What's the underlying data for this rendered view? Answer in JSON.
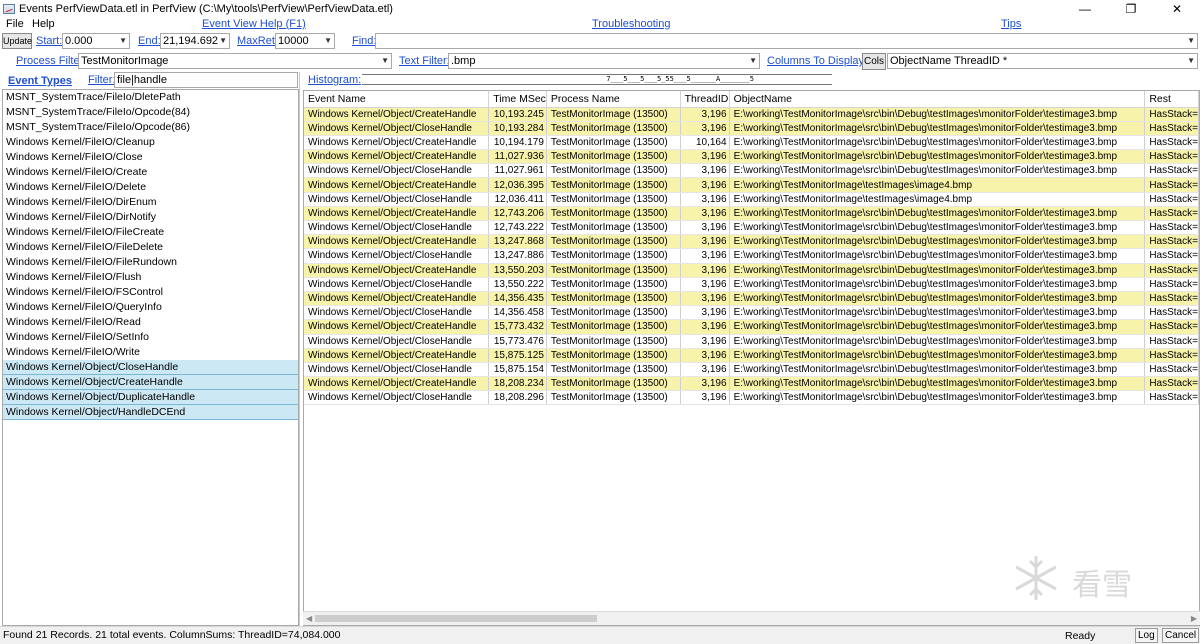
{
  "window": {
    "title": "Events PerfViewData.etl in PerfView (C:\\My\\tools\\PerfView\\PerfViewData.etl)",
    "minimize": "—",
    "maximize": "❐",
    "close": "✕"
  },
  "menu": {
    "file": "File",
    "help": "Help",
    "event_view_help": "Event View Help (F1)",
    "troubleshooting": "Troubleshooting",
    "tips": "Tips"
  },
  "toolbar": {
    "update": "Update",
    "start_label": "Start:",
    "start_value": "0.000",
    "end_label": "End:",
    "end_value": "21,194.692",
    "maxret_label": "MaxRet:",
    "maxret_value": "10000",
    "find_label": "Find:",
    "find_value": "",
    "process_filter_label": "Process Filter:",
    "process_filter_value": "TestMonitorImage",
    "text_filter_label": "Text Filter:",
    "text_filter_value": ".bmp",
    "columns_label": "Columns To Display:",
    "cols_button": "Cols",
    "columns_value": "ObjectName ThreadID *"
  },
  "left": {
    "event_types_label": "Event Types",
    "filter_label": "Filter:",
    "filter_value": "file|handle",
    "items": [
      "MSNT_SystemTrace/FileIo/DletePath",
      "MSNT_SystemTrace/FileIo/Opcode(84)",
      "MSNT_SystemTrace/FileIo/Opcode(86)",
      "Windows Kernel/FileIO/Cleanup",
      "Windows Kernel/FileIO/Close",
      "Windows Kernel/FileIO/Create",
      "Windows Kernel/FileIO/Delete",
      "Windows Kernel/FileIO/DirEnum",
      "Windows Kernel/FileIO/DirNotify",
      "Windows Kernel/FileIO/FileCreate",
      "Windows Kernel/FileIO/FileDelete",
      "Windows Kernel/FileIO/FileRundown",
      "Windows Kernel/FileIO/Flush",
      "Windows Kernel/FileIO/FSControl",
      "Windows Kernel/FileIO/QueryInfo",
      "Windows Kernel/FileIO/Read",
      "Windows Kernel/FileIO/SetInfo",
      "Windows Kernel/FileIO/Write",
      "Windows Kernel/Object/CloseHandle",
      "Windows Kernel/Object/CreateHandle",
      "Windows Kernel/Object/DuplicateHandle",
      "Windows Kernel/Object/HandleDCEnd"
    ],
    "selected_from_index": 18
  },
  "histogram": {
    "label": "Histogram:",
    "text": "                                                          7___5___5___5_55___5______A_______5"
  },
  "grid": {
    "columns": [
      "Event Name",
      "Time MSec",
      "Process Name",
      "ThreadID",
      "ObjectName",
      "Rest"
    ],
    "rows": [
      {
        "event": "Windows Kernel/Object/CreateHandle",
        "time": "10,193.245",
        "process": "TestMonitorImage (13500)",
        "thread": "3,196",
        "object": "E:\\working\\TestMonitorImage\\src\\bin\\Debug\\testImages\\monitorFolder\\testimage3.bmp",
        "rest": "HasStack=",
        "hl": true
      },
      {
        "event": "Windows Kernel/Object/CloseHandle",
        "time": "10,193.284",
        "process": "TestMonitorImage (13500)",
        "thread": "3,196",
        "object": "E:\\working\\TestMonitorImage\\src\\bin\\Debug\\testImages\\monitorFolder\\testimage3.bmp",
        "rest": "HasStack=",
        "hl": true
      },
      {
        "event": "Windows Kernel/Object/CreateHandle",
        "time": "10,194.179",
        "process": "TestMonitorImage (13500)",
        "thread": "10,164",
        "object": "E:\\working\\TestMonitorImage\\src\\bin\\Debug\\testImages\\monitorFolder\\testimage3.bmp",
        "rest": "HasStack=",
        "hl": false
      },
      {
        "event": "Windows Kernel/Object/CreateHandle",
        "time": "11,027.936",
        "process": "TestMonitorImage (13500)",
        "thread": "3,196",
        "object": "E:\\working\\TestMonitorImage\\src\\bin\\Debug\\testImages\\monitorFolder\\testimage3.bmp",
        "rest": "HasStack=",
        "hl": true
      },
      {
        "event": "Windows Kernel/Object/CloseHandle",
        "time": "11,027.961",
        "process": "TestMonitorImage (13500)",
        "thread": "3,196",
        "object": "E:\\working\\TestMonitorImage\\src\\bin\\Debug\\testImages\\monitorFolder\\testimage3.bmp",
        "rest": "HasStack=",
        "hl": false
      },
      {
        "event": "Windows Kernel/Object/CreateHandle",
        "time": "12,036.395",
        "process": "TestMonitorImage (13500)",
        "thread": "3,196",
        "object": "E:\\working\\TestMonitorImage\\testImages\\image4.bmp",
        "rest": "HasStack=",
        "hl": true
      },
      {
        "event": "Windows Kernel/Object/CloseHandle",
        "time": "12,036.411",
        "process": "TestMonitorImage (13500)",
        "thread": "3,196",
        "object": "E:\\working\\TestMonitorImage\\testImages\\image4.bmp",
        "rest": "HasStack=",
        "hl": false
      },
      {
        "event": "Windows Kernel/Object/CreateHandle",
        "time": "12,743.206",
        "process": "TestMonitorImage (13500)",
        "thread": "3,196",
        "object": "E:\\working\\TestMonitorImage\\src\\bin\\Debug\\testImages\\monitorFolder\\testimage3.bmp",
        "rest": "HasStack=",
        "hl": true
      },
      {
        "event": "Windows Kernel/Object/CloseHandle",
        "time": "12,743.222",
        "process": "TestMonitorImage (13500)",
        "thread": "3,196",
        "object": "E:\\working\\TestMonitorImage\\src\\bin\\Debug\\testImages\\monitorFolder\\testimage3.bmp",
        "rest": "HasStack=",
        "hl": false
      },
      {
        "event": "Windows Kernel/Object/CreateHandle",
        "time": "13,247.868",
        "process": "TestMonitorImage (13500)",
        "thread": "3,196",
        "object": "E:\\working\\TestMonitorImage\\src\\bin\\Debug\\testImages\\monitorFolder\\testimage3.bmp",
        "rest": "HasStack=",
        "hl": true
      },
      {
        "event": "Windows Kernel/Object/CloseHandle",
        "time": "13,247.886",
        "process": "TestMonitorImage (13500)",
        "thread": "3,196",
        "object": "E:\\working\\TestMonitorImage\\src\\bin\\Debug\\testImages\\monitorFolder\\testimage3.bmp",
        "rest": "HasStack=",
        "hl": false
      },
      {
        "event": "Windows Kernel/Object/CreateHandle",
        "time": "13,550.203",
        "process": "TestMonitorImage (13500)",
        "thread": "3,196",
        "object": "E:\\working\\TestMonitorImage\\src\\bin\\Debug\\testImages\\monitorFolder\\testimage3.bmp",
        "rest": "HasStack=",
        "hl": true
      },
      {
        "event": "Windows Kernel/Object/CloseHandle",
        "time": "13,550.222",
        "process": "TestMonitorImage (13500)",
        "thread": "3,196",
        "object": "E:\\working\\TestMonitorImage\\src\\bin\\Debug\\testImages\\monitorFolder\\testimage3.bmp",
        "rest": "HasStack=",
        "hl": false
      },
      {
        "event": "Windows Kernel/Object/CreateHandle",
        "time": "14,356.435",
        "process": "TestMonitorImage (13500)",
        "thread": "3,196",
        "object": "E:\\working\\TestMonitorImage\\src\\bin\\Debug\\testImages\\monitorFolder\\testimage3.bmp",
        "rest": "HasStack=",
        "hl": true
      },
      {
        "event": "Windows Kernel/Object/CloseHandle",
        "time": "14,356.458",
        "process": "TestMonitorImage (13500)",
        "thread": "3,196",
        "object": "E:\\working\\TestMonitorImage\\src\\bin\\Debug\\testImages\\monitorFolder\\testimage3.bmp",
        "rest": "HasStack=",
        "hl": false
      },
      {
        "event": "Windows Kernel/Object/CreateHandle",
        "time": "15,773.432",
        "process": "TestMonitorImage (13500)",
        "thread": "3,196",
        "object": "E:\\working\\TestMonitorImage\\src\\bin\\Debug\\testImages\\monitorFolder\\testimage3.bmp",
        "rest": "HasStack=",
        "hl": true
      },
      {
        "event": "Windows Kernel/Object/CloseHandle",
        "time": "15,773.476",
        "process": "TestMonitorImage (13500)",
        "thread": "3,196",
        "object": "E:\\working\\TestMonitorImage\\src\\bin\\Debug\\testImages\\monitorFolder\\testimage3.bmp",
        "rest": "HasStack=",
        "hl": false
      },
      {
        "event": "Windows Kernel/Object/CreateHandle",
        "time": "15,875.125",
        "process": "TestMonitorImage (13500)",
        "thread": "3,196",
        "object": "E:\\working\\TestMonitorImage\\src\\bin\\Debug\\testImages\\monitorFolder\\testimage3.bmp",
        "rest": "HasStack=",
        "hl": true
      },
      {
        "event": "Windows Kernel/Object/CloseHandle",
        "time": "15,875.154",
        "process": "TestMonitorImage (13500)",
        "thread": "3,196",
        "object": "E:\\working\\TestMonitorImage\\src\\bin\\Debug\\testImages\\monitorFolder\\testimage3.bmp",
        "rest": "HasStack=",
        "hl": false
      },
      {
        "event": "Windows Kernel/Object/CreateHandle",
        "time": "18,208.234",
        "process": "TestMonitorImage (13500)",
        "thread": "3,196",
        "object": "E:\\working\\TestMonitorImage\\src\\bin\\Debug\\testImages\\monitorFolder\\testimage3.bmp",
        "rest": "HasStack=",
        "hl": true
      },
      {
        "event": "Windows Kernel/Object/CloseHandle",
        "time": "18,208.296",
        "process": "TestMonitorImage (13500)",
        "thread": "3,196",
        "object": "E:\\working\\TestMonitorImage\\src\\bin\\Debug\\testImages\\monitorFolder\\testimage3.bmp",
        "rest": "HasStack=",
        "hl": false
      }
    ]
  },
  "status": {
    "text": "Found 21 Records.  21 total events. ColumnSums: ThreadID=74,084.000",
    "ready": "Ready",
    "log": "Log",
    "cancel": "Cancel"
  },
  "watermark": {
    "text": "看雪"
  },
  "colors": {
    "link": "#1f4fcf",
    "row_highlight": "#f8f3ab",
    "selected_item": "#cce8f4"
  }
}
